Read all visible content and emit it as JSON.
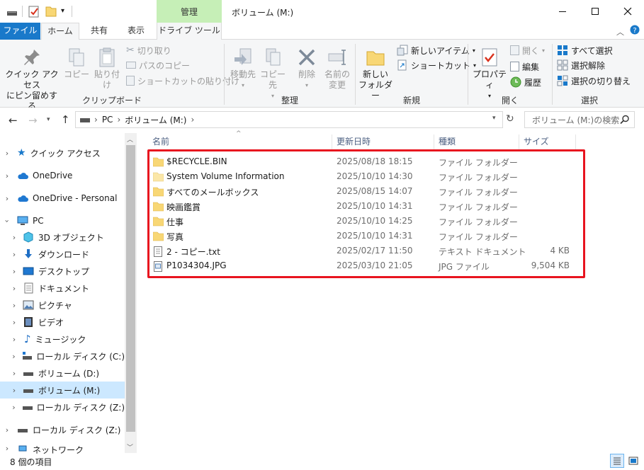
{
  "window": {
    "title": "ボリューム (M:)",
    "contextual_group": "管理"
  },
  "tabs": {
    "file": "ファイル",
    "home": "ホーム",
    "share": "共有",
    "view": "表示",
    "drive_tools": "ドライブ ツール"
  },
  "ribbon": {
    "clipboard": {
      "label": "クリップボード",
      "pin": "クイック アクセス\nにピン留めする",
      "pin_line1": "クイック アクセス",
      "pin_line2": "にピン留めする",
      "copy": "コピー",
      "paste": "貼り付け",
      "cut": "切り取り",
      "copy_path": "パスのコピー",
      "paste_shortcut": "ショートカットの貼り付け"
    },
    "organize": {
      "label": "整理",
      "move_to": "移動先",
      "copy_to": "コピー先",
      "delete": "削除",
      "rename_line1": "名前の",
      "rename_line2": "変更"
    },
    "new": {
      "label": "新規",
      "new_folder_line1": "新しい",
      "new_folder_line2": "フォルダー",
      "new_item": "新しいアイテム",
      "shortcut": "ショートカット"
    },
    "open": {
      "label": "開く",
      "properties": "プロパティ",
      "open": "開く",
      "edit": "編集",
      "history": "履歴"
    },
    "select": {
      "label": "選択",
      "select_all": "すべて選択",
      "select_none": "選択解除",
      "invert": "選択の切り替え"
    }
  },
  "address": {
    "path": [
      "PC",
      "ボリューム (M:)"
    ],
    "search_placeholder": "ボリューム (M:)の検索"
  },
  "nav": {
    "items": [
      {
        "label": "クイック アクセス",
        "icon": "star-icon"
      },
      {
        "label": "OneDrive",
        "icon": "cloud-icon"
      },
      {
        "label": "OneDrive - Personal",
        "icon": "cloud-icon"
      },
      {
        "label": "PC",
        "icon": "pc-icon"
      },
      {
        "label": "3D オブジェクト",
        "icon": "cube-icon"
      },
      {
        "label": "ダウンロード",
        "icon": "download-icon"
      },
      {
        "label": "デスクトップ",
        "icon": "desktop-icon"
      },
      {
        "label": "ドキュメント",
        "icon": "document-icon"
      },
      {
        "label": "ピクチャ",
        "icon": "pictures-icon"
      },
      {
        "label": "ビデオ",
        "icon": "video-icon"
      },
      {
        "label": "ミュージック",
        "icon": "music-icon"
      },
      {
        "label": "ローカル ディスク (C:)",
        "icon": "drive-icon"
      },
      {
        "label": "ボリューム (D:)",
        "icon": "drive-icon"
      },
      {
        "label": "ボリューム (M:)",
        "icon": "drive-icon"
      },
      {
        "label": "ローカル ディスク (Z:)",
        "icon": "drive-icon"
      },
      {
        "label": "ローカル ディスク (Z:)",
        "icon": "drive-icon"
      },
      {
        "label": "ネットワーク",
        "icon": "network-icon"
      }
    ]
  },
  "columns": {
    "name": "名前",
    "modified": "更新日時",
    "type": "種類",
    "size": "サイズ"
  },
  "files": [
    {
      "name": "$RECYCLE.BIN",
      "modified": "2025/08/18 18:15",
      "type": "ファイル フォルダー",
      "size": "",
      "icon": "folder-icon"
    },
    {
      "name": "System Volume Information",
      "modified": "2025/10/10 14:30",
      "type": "ファイル フォルダー",
      "size": "",
      "icon": "folder-icon"
    },
    {
      "name": "すべてのメールボックス",
      "modified": "2025/08/15 14:07",
      "type": "ファイル フォルダー",
      "size": "",
      "icon": "folder-icon"
    },
    {
      "name": "映画鑑賞",
      "modified": "2025/10/10 14:31",
      "type": "ファイル フォルダー",
      "size": "",
      "icon": "folder-icon"
    },
    {
      "name": "仕事",
      "modified": "2025/10/10 14:25",
      "type": "ファイル フォルダー",
      "size": "",
      "icon": "folder-icon"
    },
    {
      "name": "写真",
      "modified": "2025/10/10 14:31",
      "type": "ファイル フォルダー",
      "size": "",
      "icon": "folder-icon"
    },
    {
      "name": "2 - コピー.txt",
      "modified": "2025/02/17 11:50",
      "type": "テキスト ドキュメント",
      "size": "4 KB",
      "icon": "text-file-icon"
    },
    {
      "name": "P1034304.JPG",
      "modified": "2025/03/10 21:05",
      "type": "JPG ファイル",
      "size": "9,504 KB",
      "icon": "image-file-icon"
    }
  ],
  "status": {
    "item_count": "8 個の項目"
  },
  "colors": {
    "accent": "#1979ca",
    "contextual": "#c6efb7",
    "highlight": "#e8141f",
    "selection": "#cce8ff",
    "folder": "#f8d775"
  }
}
